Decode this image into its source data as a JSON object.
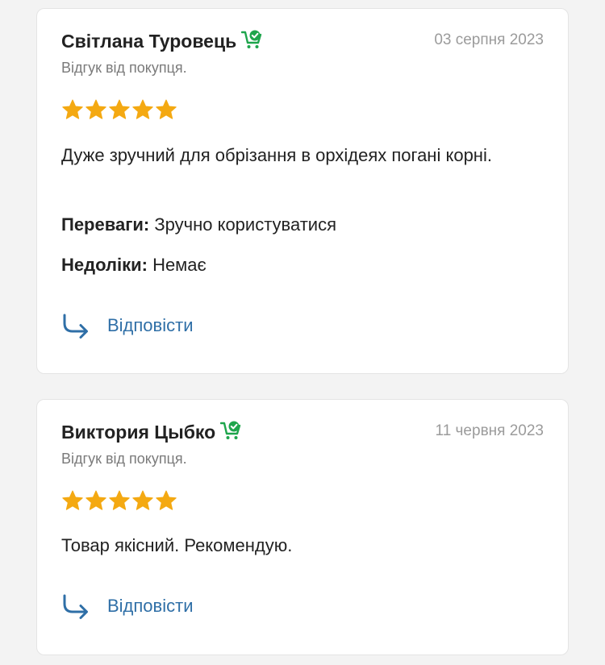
{
  "reviews": [
    {
      "author": "Світлана Туровець",
      "badge_icon": "verified-buyer-cart-icon",
      "date": "03 серпня 2023",
      "subtitle": "Відгук від покупця.",
      "rating": 5,
      "comment": "Дуже зручний для обрізання в орхідеях погані корні.",
      "pros_label": "Переваги:",
      "pros": "Зручно користуватися",
      "cons_label": "Недоліки:",
      "cons": "Немає",
      "reply_label": "Відповісти"
    },
    {
      "author": "Виктория Цыбко",
      "badge_icon": "verified-buyer-cart-icon",
      "date": "11 червня 2023",
      "subtitle": "Відгук від покупця.",
      "rating": 5,
      "comment": "Товар якісний. Рекомендую.",
      "reply_label": "Відповісти"
    }
  ],
  "colors": {
    "star": "#f4a912",
    "link": "#2f6fa7",
    "badge": "#1ea54c",
    "date": "#9b9b9b",
    "subtitle": "#7a7a7a"
  }
}
